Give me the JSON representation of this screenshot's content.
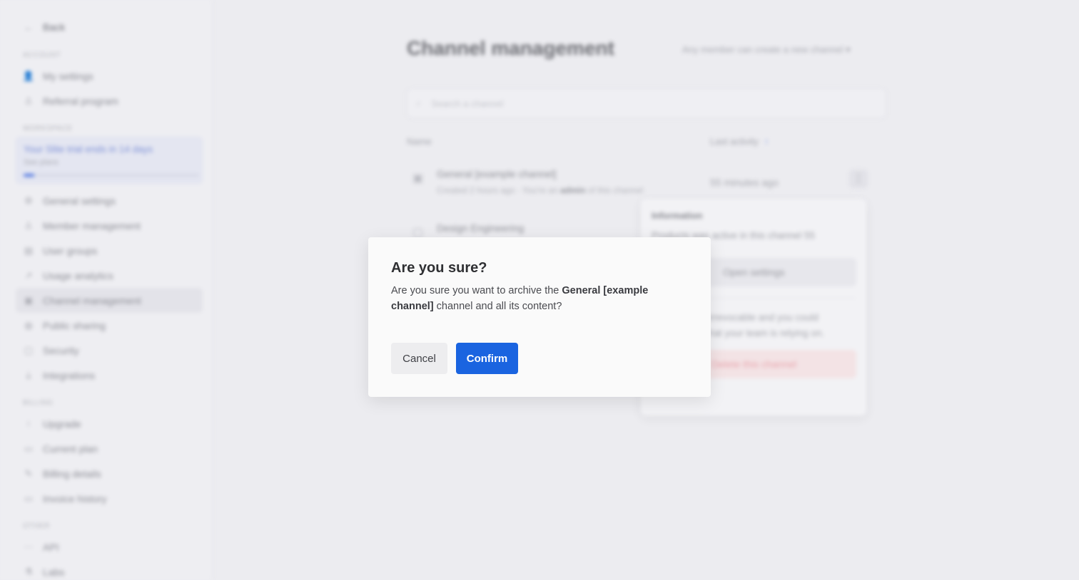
{
  "sidebar": {
    "back_label": "Back",
    "account_label": "ACCOUNT",
    "account_items": [
      "My settings",
      "Referral program"
    ],
    "workspace_label": "WORKSPACE",
    "trial": {
      "title": "Your Slite trial ends in 14 days",
      "subtitle": "See plans",
      "progress_fraction": 0.06
    },
    "workspace_items": [
      "General settings",
      "Member management",
      "User groups",
      "Usage analytics",
      "Channel management",
      "Public sharing",
      "Security",
      "Integrations"
    ],
    "billing_label": "BILLING",
    "billing_items": [
      "Upgrade",
      "Current plan",
      "Billing details",
      "Invoice history"
    ],
    "other_label": "OTHER",
    "other_items": [
      "API",
      "Labs"
    ]
  },
  "main": {
    "title": "Channel management",
    "creator_dropdown": "Any member can create a new channel",
    "search_placeholder": "Search a channel",
    "columns": {
      "name": "Name",
      "activity": "Last activity"
    },
    "rows": [
      {
        "name": "General [example channel]",
        "meta_prefix": "Created 2 hours ago · You're an",
        "meta_role": "admin",
        "meta_suffix": "of this channel",
        "time": "55 minutes ago"
      },
      {
        "name": "Design Engineering"
      }
    ]
  },
  "context_menu": {
    "title": "Information",
    "text": "Products was active in this channel 55",
    "open_settings": "Open settings",
    "warning_line1": "irrevocable and you could",
    "warning_line2": "hat your team is relying on.",
    "delete": "Delete this channel"
  },
  "dialog": {
    "title": "Are you sure?",
    "body_prefix": "Are you sure you want to archive the",
    "channel_name": "General [example channel]",
    "body_suffix": "channel and all its content?",
    "cancel_label": "Cancel",
    "confirm_label": "Confirm"
  },
  "colors": {
    "accent": "#1a64e0",
    "danger": "#e8a3ab"
  }
}
